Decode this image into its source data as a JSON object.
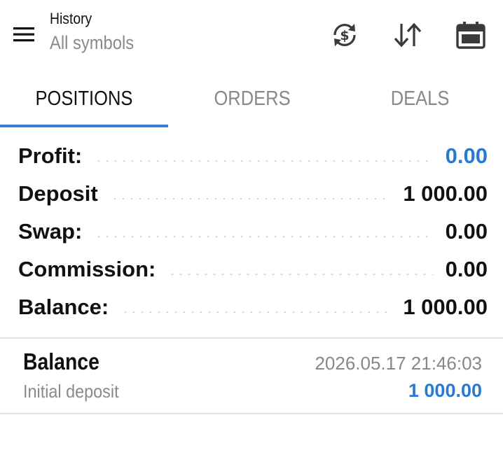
{
  "header": {
    "title": "History",
    "subtitle": "All symbols",
    "icons": [
      "menu-icon",
      "currency-refresh-icon",
      "sort-icon",
      "calendar-icon"
    ]
  },
  "tabs": [
    {
      "label": "POSITIONS",
      "active": true
    },
    {
      "label": "ORDERS",
      "active": false
    },
    {
      "label": "DEALS",
      "active": false
    }
  ],
  "summary": [
    {
      "label": "Profit:",
      "value": "0.00",
      "color": "#2979d4"
    },
    {
      "label": "Deposit",
      "value": "1 000.00",
      "color": "#111111"
    },
    {
      "label": "Swap:",
      "value": "0.00",
      "color": "#111111"
    },
    {
      "label": "Commission:",
      "value": "0.00",
      "color": "#111111"
    },
    {
      "label": "Balance:",
      "value": "1 000.00",
      "color": "#111111"
    }
  ],
  "deals": [
    {
      "type": "Balance",
      "time": "2026.05.17 21:46:03",
      "comment": "Initial deposit",
      "amount": "1 000.00"
    }
  ],
  "colors": {
    "accent": "#3a7fd5",
    "value_blue": "#2979d4",
    "muted_text": "#888888"
  }
}
